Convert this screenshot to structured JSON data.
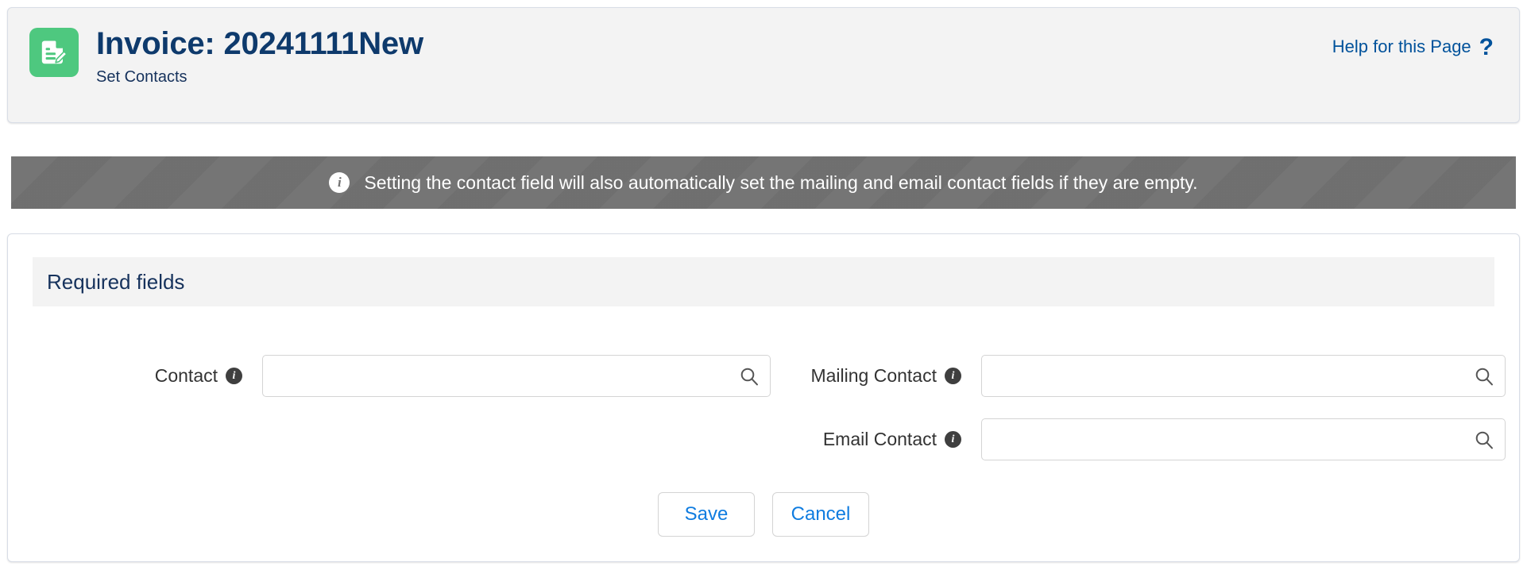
{
  "header": {
    "icon": "invoice-document-edit-icon",
    "title": "Invoice: 20241111New",
    "subtitle": "Set Contacts",
    "help_label": "Help for this Page",
    "help_glyph": "?",
    "accent_color": "#4ec87f",
    "title_color": "#0e3a6c"
  },
  "banner": {
    "icon": "info-icon",
    "icon_glyph": "i",
    "message": "Setting the contact field will also automatically set the mailing and email contact fields if they are empty.",
    "background_color": "#727272",
    "text_color": "#ffffff"
  },
  "form": {
    "section_title": "Required fields",
    "fields": [
      {
        "label": "Contact",
        "value": "",
        "placeholder": "",
        "info_glyph": "i",
        "lookup_icon": "search-icon"
      },
      {
        "label": "Mailing Contact",
        "value": "",
        "placeholder": "",
        "info_glyph": "i",
        "lookup_icon": "search-icon"
      },
      {
        "label": "Email Contact",
        "value": "",
        "placeholder": "",
        "info_glyph": "i",
        "lookup_icon": "search-icon"
      }
    ]
  },
  "actions": {
    "save_label": "Save",
    "cancel_label": "Cancel",
    "link_color": "#0f7ce0"
  }
}
